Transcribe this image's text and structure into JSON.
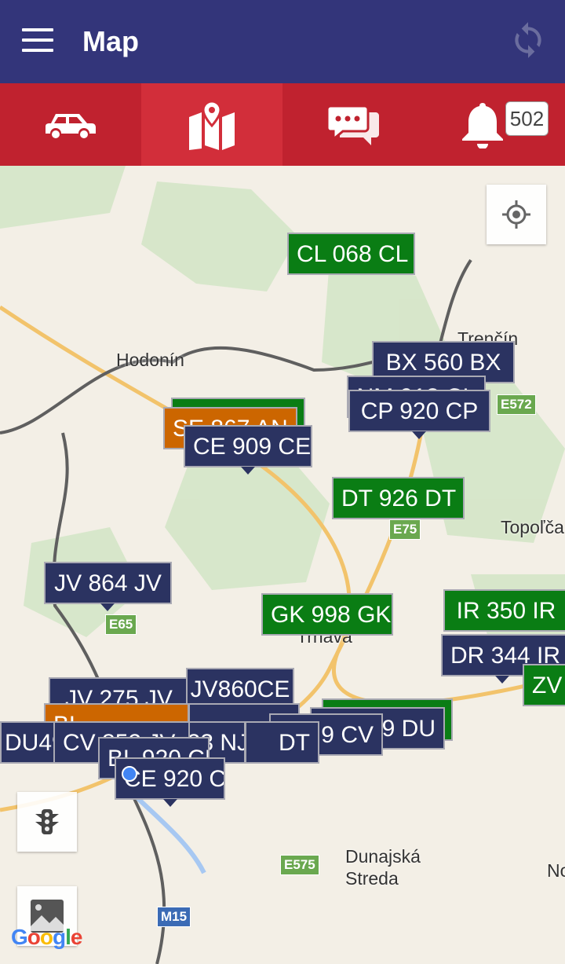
{
  "appbar": {
    "title": "Map",
    "menu_icon": "hamburger-icon",
    "refresh_icon": "refresh-icon"
  },
  "tabs": [
    {
      "name": "vehicles",
      "icon": "car-icon"
    },
    {
      "name": "map",
      "icon": "map-pin-icon",
      "selected": true
    },
    {
      "name": "messages",
      "icon": "chat-icon"
    },
    {
      "name": "notifications",
      "icon": "bell-icon",
      "badge": "502"
    }
  ],
  "colors": {
    "appbar": "#33357a",
    "tabs": "#c0222f",
    "marker_navy": "#2b3361",
    "marker_green": "#0a7d14",
    "marker_orange": "#cc6600"
  },
  "places": [
    "Hodonín",
    "Trenčín",
    "Topoľča",
    "Trnava",
    "Dunajská",
    "Streda",
    "No"
  ],
  "roads": [
    "E572",
    "E75",
    "E65",
    "E575",
    "M15"
  ],
  "markers": [
    "CL 068 CL",
    "BX 560 BX",
    "NM 918 CL",
    "CP 920 CP",
    "SE 867 AN",
    "CE 909 CE",
    "DT 926 DT",
    "JV 864 JV",
    "GK 998 GK",
    "IR 350 IR",
    "DR 344 IR",
    "ZV",
    "JV 275 JV",
    "JV860CE",
    "9 DU",
    "BL",
    "9 CV",
    "DT",
    "DU49",
    "CV 852 JV",
    "923 NJ",
    "BL 920 CE",
    "CE 920 CE"
  ],
  "attribution": "Google"
}
